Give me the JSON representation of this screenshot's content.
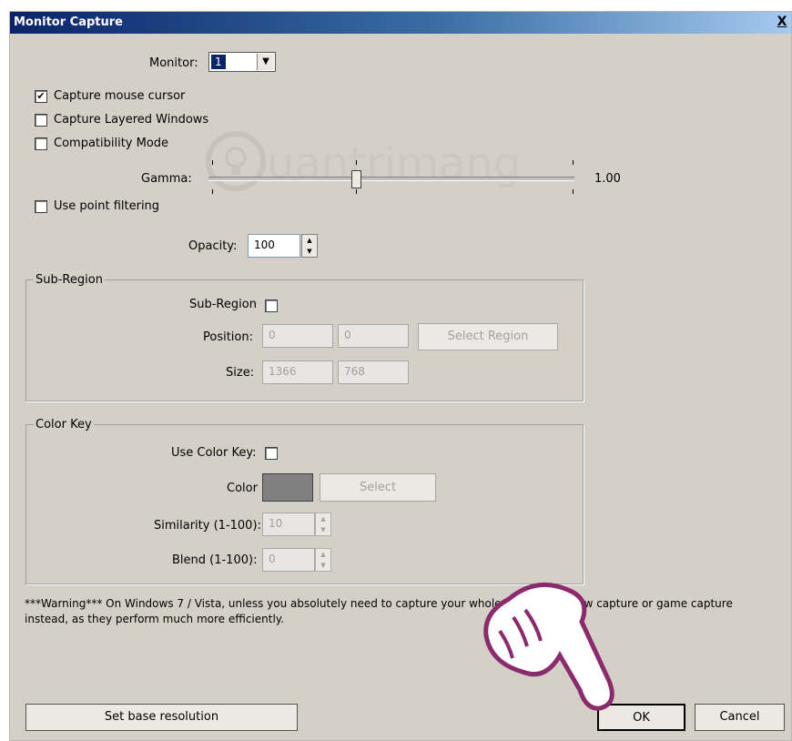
{
  "window": {
    "title": "Monitor Capture",
    "close_glyph": "X"
  },
  "monitor": {
    "label": "Monitor:",
    "value": "1",
    "arrow": "▼"
  },
  "options": {
    "capture_cursor": {
      "label": "Capture mouse cursor",
      "checked": true
    },
    "layered_windows": {
      "label": "Capture Layered Windows",
      "checked": false
    },
    "compatibility": {
      "label": "Compatibility Mode",
      "checked": false
    },
    "point_filtering": {
      "label": "Use point filtering",
      "checked": false
    }
  },
  "gamma": {
    "label": "Gamma:",
    "value_text": "1.00",
    "position": 0.5
  },
  "opacity": {
    "label": "Opacity:",
    "value": "100"
  },
  "sub_region": {
    "group_title": "Sub-Region",
    "enable_label": "Sub-Region",
    "position_label": "Position:",
    "pos_x": "0",
    "pos_y": "0",
    "select_region_label": "Select Region",
    "size_label": "Size:",
    "width": "1366",
    "height": "768"
  },
  "color_key": {
    "group_title": "Color Key",
    "use_label": "Use Color Key:",
    "color_label": "Color",
    "color_value": "#808080",
    "select_label": "Select",
    "similarity_label": "Similarity (1-100):",
    "similarity_value": "10",
    "blend_label": "Blend (1-100):",
    "blend_value": "0"
  },
  "warning": "***Warning*** On Windows 7 / Vista, unless you absolutely need to capture your whole de     , use window capture or game capture instead, as they perform much more efficiently.",
  "buttons": {
    "base_resolution": "Set base resolution",
    "ok": "OK",
    "cancel": "Cancel"
  },
  "watermark": {
    "text": "uantrimang"
  },
  "colors": {
    "title_start": "#0a246a",
    "title_end": "#a6caf0",
    "dialog_bg": "#d4d0c8",
    "hand": "#8b2a6d"
  }
}
